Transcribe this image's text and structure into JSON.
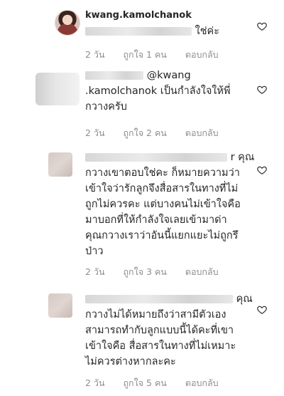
{
  "comments": [
    {
      "username": "kwang.kamolchanok",
      "line1_suffix": "ใช่ค่ะ",
      "time": "2 วัน",
      "likes": "ถูกใจ 1 คน",
      "reply": "ตอบกลับ"
    },
    {
      "line1_suffix": "@kwang",
      "line2": ".kamolchanok เป็นกำลังใจให้พี่",
      "line3": "กวางครับ",
      "time": "2 วัน",
      "likes": "ถูกใจ 2 คน",
      "reply": "ตอบกลับ"
    },
    {
      "line1_suffix": "r คุณ",
      "lines": [
        "กวางเขาตอบใช่คะ ก็หมายความว่า",
        "เข้าใจว่ารักลูกจึงสื่อสารในทางที่ไม่",
        "ถูกไม่ควรคะ แต่บางคนไม่เข้าใจคือ",
        "มาบอกที่ให้กำลังใจเลยเข้ามาด่า",
        "คุณกวางเราว่าอันนี้แยกแยะไม่ถูกรึ",
        "ป่าว"
      ],
      "time": "2 วัน",
      "likes": "ถูกใจ 3 คน",
      "reply": "ตอบกลับ"
    },
    {
      "line1_suffix": "คุณ",
      "lines": [
        "กวางไม่ได้หมายถึงว่าสามีตัวเอง",
        "สามารถทำกับลูกแบบนี้ได้คะที่เขา",
        "เข้าใจคือ สื่อสารในทางที่ไม่เหมาะ",
        "ไม่ควรต่างหากละคะ"
      ],
      "time": "2 วัน",
      "likes": "ถูกใจ 5 คน",
      "reply": "ตอบกลับ"
    }
  ],
  "icons": {
    "like": "heart-outline-icon"
  }
}
